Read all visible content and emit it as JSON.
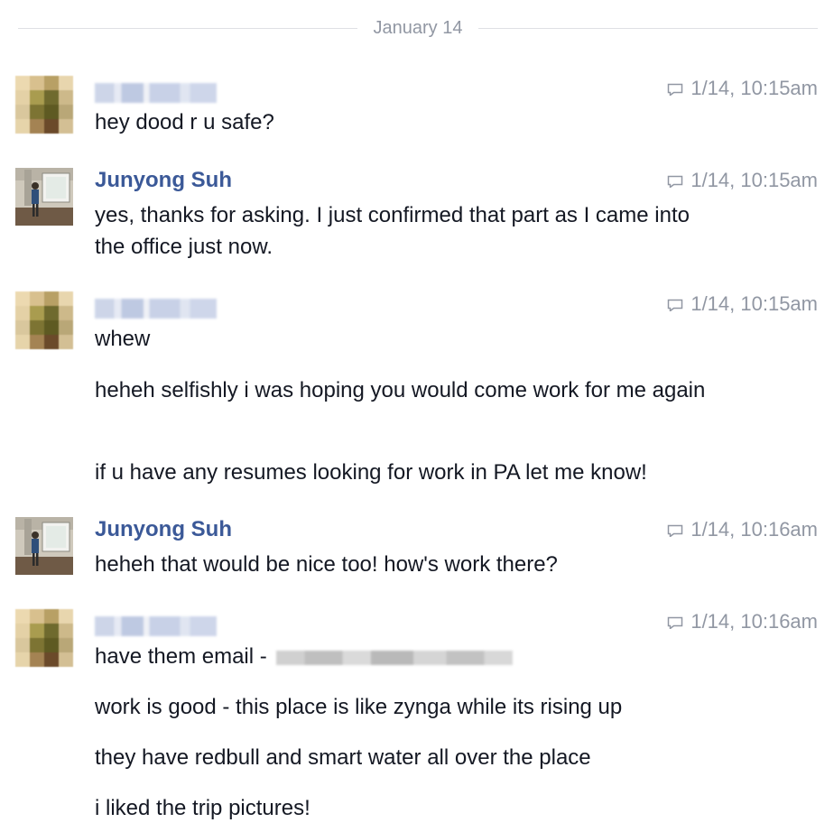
{
  "date_divider": "January 14",
  "avatars": {
    "friend_pixel_colors": [
      "#ecd9b0",
      "#d8c08e",
      "#b8a065",
      "#e8d6ae",
      "#e4d1a6",
      "#a99c4f",
      "#6f6a2e",
      "#cdb98a",
      "#d9c79d",
      "#7d7433",
      "#5e5a22",
      "#b9a777",
      "#e6d4aa",
      "#a48353",
      "#6b4a2a",
      "#d3bf94"
    ]
  },
  "messages": [
    {
      "sender": "",
      "sender_blurred": true,
      "timestamp": "1/14, 10:15am",
      "lines": [
        "hey dood r u safe?"
      ]
    },
    {
      "sender": "Junyong Suh",
      "sender_blurred": false,
      "timestamp": "1/14, 10:15am",
      "lines": [
        "yes, thanks for asking. I just confirmed that part as I came into the office just now."
      ]
    },
    {
      "sender": "",
      "sender_blurred": true,
      "timestamp": "1/14, 10:15am",
      "lines": [
        "whew",
        "heheh selfishly i was hoping you would come work for me again",
        "if u have any resumes looking for work in PA let me know!"
      ]
    },
    {
      "sender": "Junyong Suh",
      "sender_blurred": false,
      "timestamp": "1/14, 10:16am",
      "lines": [
        "heheh that would be nice too! how's work there?"
      ]
    },
    {
      "sender": "",
      "sender_blurred": true,
      "timestamp": "1/14, 10:16am",
      "lines": [
        "have them email -",
        "work is good - this place is like zynga while its rising up",
        "they have redbull and smart water all over the place",
        "i liked the trip pictures!"
      ]
    }
  ]
}
